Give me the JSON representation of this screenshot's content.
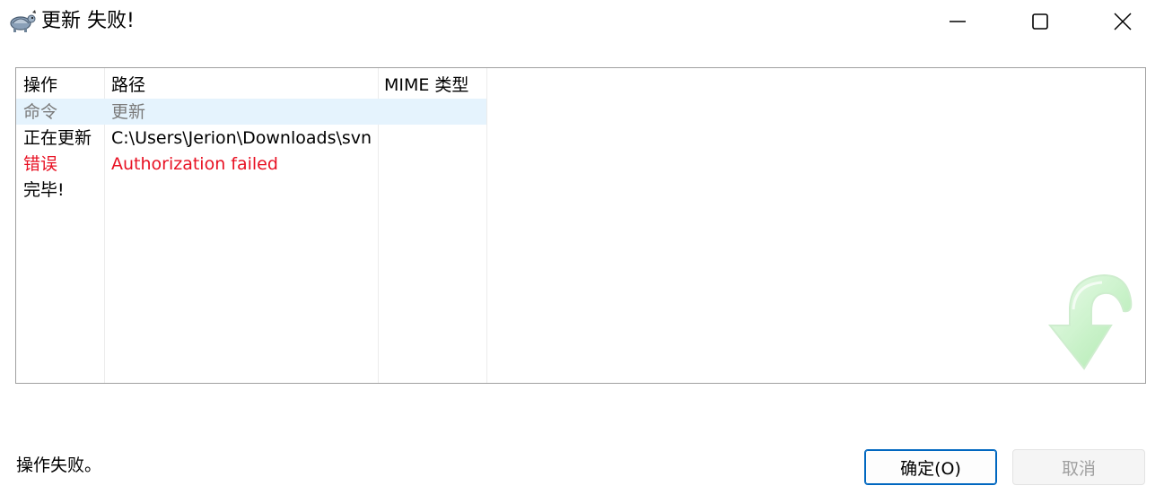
{
  "window": {
    "title": "更新 失败!",
    "app_icon": "tortoise-svn-icon"
  },
  "list": {
    "columns": [
      "操作",
      "路径",
      "MIME 类型"
    ],
    "rows": [
      {
        "action": "命令",
        "path": "更新",
        "mime": "",
        "style": "gray",
        "selected": true
      },
      {
        "action": "正在更新",
        "path": "C:\\Users\\Jerion\\Downloads\\svn",
        "mime": "",
        "style": "black",
        "selected": false
      },
      {
        "action": "错误",
        "path": "Authorization failed",
        "mime": "",
        "style": "red",
        "selected": false
      },
      {
        "action": "完毕!",
        "path": "",
        "mime": "",
        "style": "black",
        "selected": false
      }
    ]
  },
  "status": {
    "text": "操作失败。"
  },
  "buttons": {
    "ok_label": "确定(O)",
    "cancel_label": "取消"
  },
  "colors": {
    "error": "#e81123",
    "selection": "#e5f3fd",
    "accent": "#0067c0",
    "watermark_arrow": "#b8f0b8"
  }
}
